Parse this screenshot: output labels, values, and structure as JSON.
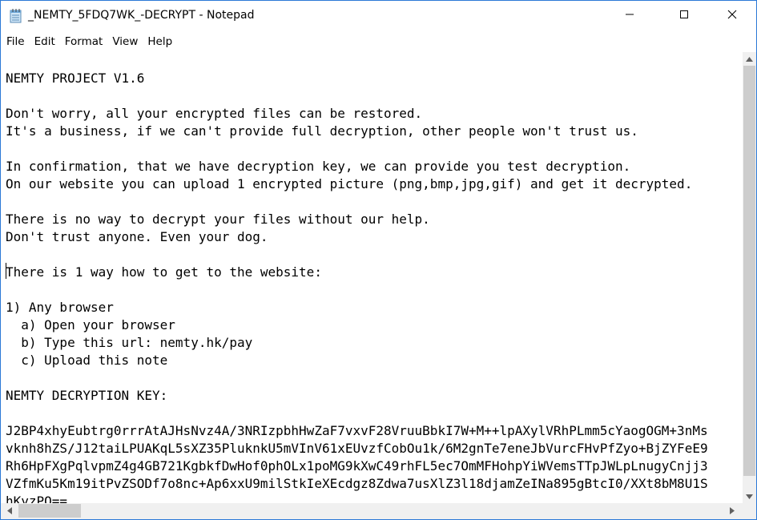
{
  "window": {
    "title": "_NEMTY_5FDQ7WK_-DECRYPT - Notepad",
    "app_icon": "notepad-icon",
    "controls": [
      "minimize-icon",
      "maximize-icon",
      "close-icon"
    ]
  },
  "menubar": {
    "items": [
      "File",
      "Edit",
      "Format",
      "View",
      "Help"
    ]
  },
  "document": {
    "lines": [
      "NEMTY PROJECT V1.6",
      "",
      "Don't worry, all your encrypted files can be restored.",
      "It's a business, if we can't provide full decryption, other people won't trust us.",
      "",
      "In confirmation, that we have decryption key, we can provide you test decryption.",
      "On our website you can upload 1 encrypted picture (png,bmp,jpg,gif) and get it decrypted.",
      "",
      "There is no way to decrypt your files without our help.",
      "Don't trust anyone. Even your dog.",
      "",
      "There is 1 way how to get to the website:",
      "",
      "1) Any browser",
      "  a) Open your browser",
      "  b) Type this url: nemty.hk/pay",
      "  c) Upload this note",
      "",
      "NEMTY DECRYPTION KEY:",
      "",
      "J2BP4xhyEubtrg0rrrAtAJHsNvz4A/3NRIzpbhHwZaF7vxvF28VruuBbkI7W+M++lpAXylVRhPLmm5cYaogOGM+3nMs",
      "vknh8hZS/J12taiLPUAKqL5sXZ35PluknkU5mVInV61xEUvzfCobOu1k/6M2gnTe7eneJbVurcFHvPfZyo+BjZYFeE9",
      "Rh6HpFXgPqlvpmZ4g4GB721KgbkfDwHof0phOLx1poMG9kXwC49rhFL5ec7OmMFHohpYiWVemsTTpJWLpLnugyCnjj3",
      "VZfmKu5Km19itPvZSODf7o8nc+Ap6xxU9milStkIeXEcdgz8Zdwa7usXlZ3l18djamZeINa895gBtcI0/XXt8bM8U1S",
      "hKyzPQ=="
    ]
  }
}
